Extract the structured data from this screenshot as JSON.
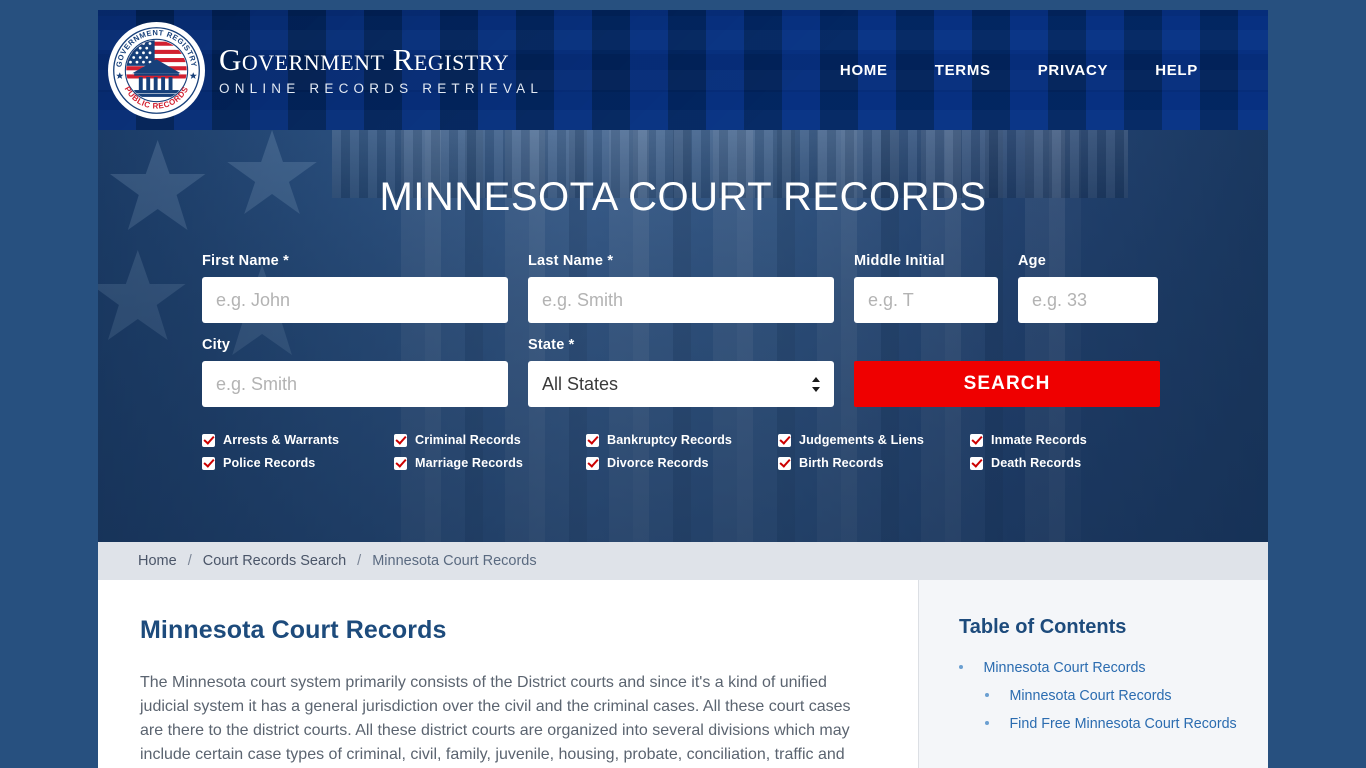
{
  "brand": {
    "title": "Government Registry",
    "subtitle": "ONLINE RECORDS RETRIEVAL",
    "seal_top_text": "GOVERNMENT REGISTRY",
    "seal_bottom_text": "PUBLIC RECORDS"
  },
  "nav": {
    "items": [
      {
        "label": "HOME"
      },
      {
        "label": "TERMS"
      },
      {
        "label": "PRIVACY"
      },
      {
        "label": "HELP"
      }
    ]
  },
  "hero": {
    "title": "MINNESOTA COURT RECORDS",
    "fields": {
      "first_name": {
        "label": "First Name *",
        "placeholder": "e.g. John",
        "value": ""
      },
      "last_name": {
        "label": "Last Name *",
        "placeholder": "e.g. Smith",
        "value": ""
      },
      "middle_initial": {
        "label": "Middle Initial",
        "placeholder": "e.g. T",
        "value": ""
      },
      "age": {
        "label": "Age",
        "placeholder": "e.g. 33",
        "value": ""
      },
      "city": {
        "label": "City",
        "placeholder": "e.g. Smith",
        "value": ""
      },
      "state": {
        "label": "State *",
        "selected": "All States"
      }
    },
    "search_button": "SEARCH",
    "checkboxes": [
      {
        "label": "Arrests & Warrants",
        "checked": true
      },
      {
        "label": "Criminal Records",
        "checked": true
      },
      {
        "label": "Bankruptcy Records",
        "checked": true
      },
      {
        "label": "Judgements & Liens",
        "checked": true
      },
      {
        "label": "Inmate Records",
        "checked": true
      },
      {
        "label": "Police Records",
        "checked": true
      },
      {
        "label": "Marriage Records",
        "checked": true
      },
      {
        "label": "Divorce Records",
        "checked": true
      },
      {
        "label": "Birth Records",
        "checked": true
      },
      {
        "label": "Death Records",
        "checked": true
      }
    ]
  },
  "breadcrumb": {
    "separator": "/",
    "items": [
      {
        "label": "Home"
      },
      {
        "label": "Court Records Search"
      },
      {
        "label": "Minnesota Court Records"
      }
    ]
  },
  "article": {
    "heading": "Minnesota Court Records",
    "paragraph": "The Minnesota court system primarily consists of the District courts and since it's a kind of unified judicial system it has a general jurisdiction over the civil and the criminal cases. All these court cases are there to the district courts. All these district courts are organized into several divisions which may include certain case types of criminal, civil, family, juvenile, housing, probate, conciliation, traffic and"
  },
  "toc": {
    "heading": "Table of Contents",
    "items": [
      {
        "label": "Minnesota Court Records",
        "children": [
          {
            "label": "Minnesota Court Records"
          },
          {
            "label": "Find Free Minnesota Court Records"
          }
        ]
      }
    ]
  },
  "colors": {
    "header_blue": "#03356c",
    "hero_blue": "#2d5585",
    "accent_red": "#ef0000",
    "link_blue": "#2b6cb0",
    "heading_blue": "#1d4b7c",
    "page_bg": "#27507f"
  }
}
